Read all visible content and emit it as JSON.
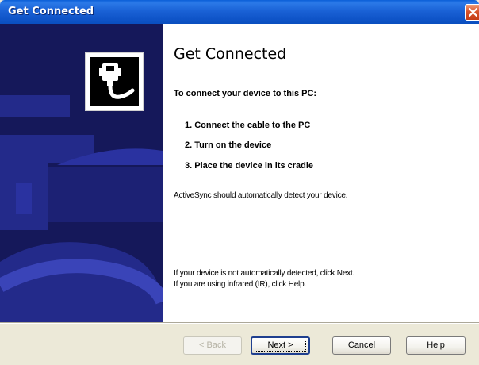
{
  "window": {
    "title": "Get Connected",
    "close_icon": "close-x"
  },
  "sidebar": {
    "icon": "device-cable-icon"
  },
  "content": {
    "heading": "Get Connected",
    "intro": "To connect your device to this PC:",
    "steps": [
      "1. Connect the cable to the PC",
      "2. Turn on the device",
      "3. Place the device in its cradle"
    ],
    "detect_text": "ActiveSync should automatically detect your device.",
    "help_lines": [
      "If your device is not automatically detected, click Next.",
      "If you are using infrared (IR), click Help."
    ]
  },
  "buttons": {
    "back": "< Back",
    "next": "Next >",
    "cancel": "Cancel",
    "help": "Help",
    "back_enabled": false
  },
  "colors": {
    "title_bar": "#1a62d6",
    "sidebar_bg": "#15185a",
    "sidebar_art": "#232a8a"
  }
}
